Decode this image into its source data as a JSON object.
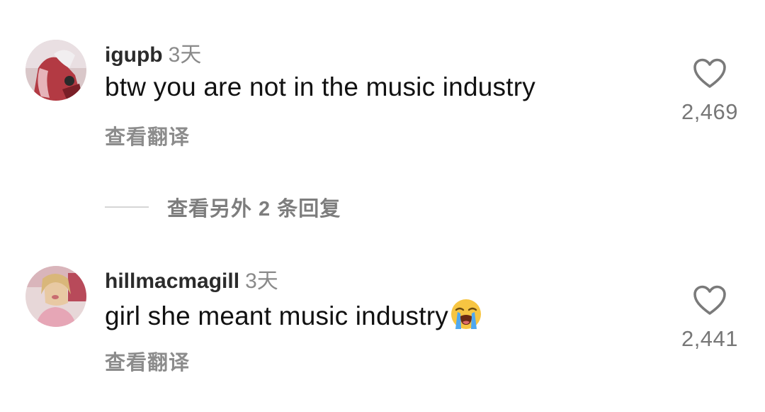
{
  "comments": [
    {
      "username": "igupb",
      "time": "3天",
      "text": "btw you are not in the music industry",
      "translate_label": "查看翻译",
      "likes": "2,469",
      "avatar_icon": "user-avatar"
    },
    {
      "username": "hillmacmagill",
      "time": "3天",
      "text": "girl she meant music industry",
      "emoji": "loudly-crying-face-emoji",
      "translate_label": "查看翻译",
      "likes": "2,441",
      "avatar_icon": "user-avatar"
    }
  ],
  "replies": {
    "view_more_label": "查看另外 2 条回复"
  },
  "icons": {
    "like": "heart-outline-icon"
  },
  "colors": {
    "username": "#2b2b2b",
    "muted": "#8a8a8a",
    "text": "#111111"
  }
}
